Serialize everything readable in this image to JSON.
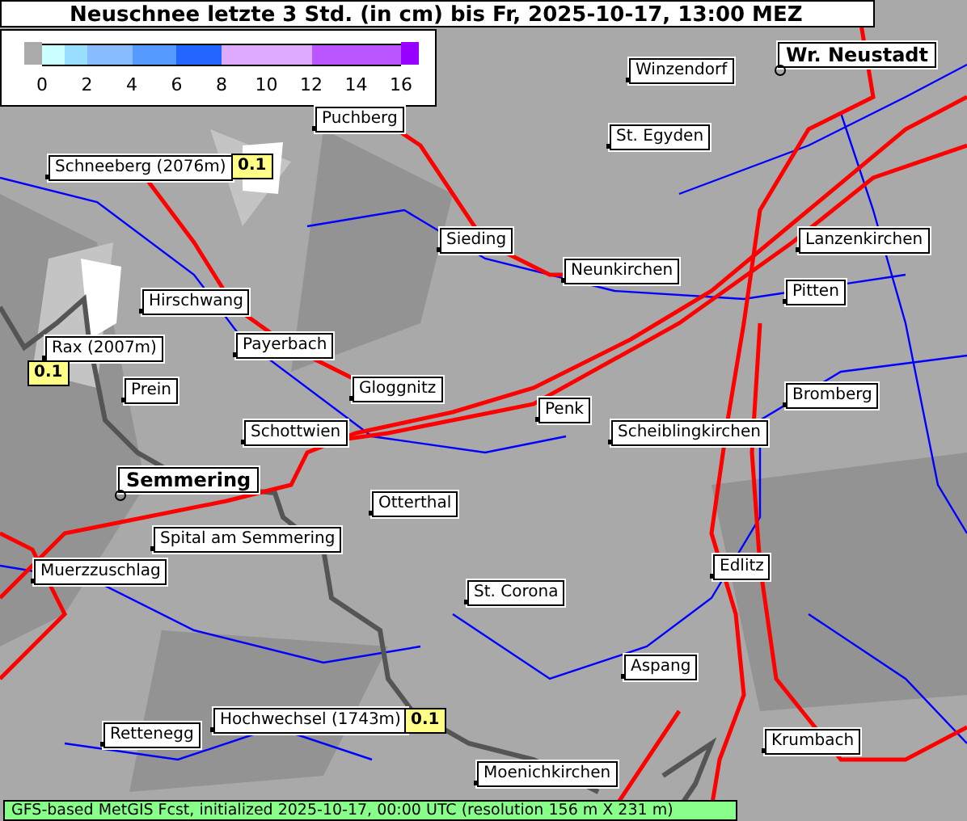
{
  "title": "Neuschnee letzte 3 Std. (in cm) bis Fr, 2025-10-17, 13:00 MEZ",
  "legend": {
    "ticks": [
      "0",
      "2",
      "4",
      "6",
      "8",
      "10",
      "12",
      "14",
      "16"
    ],
    "segments": [
      {
        "color": "#ccffff"
      },
      {
        "color": "#99ddff"
      },
      {
        "color": "#88bbff"
      },
      {
        "color": "#5599ff"
      },
      {
        "color": "#2266ff"
      },
      {
        "color": "#ddaaff"
      },
      {
        "color": "#bb55ff"
      }
    ]
  },
  "places": [
    {
      "name": "Winzendorf",
      "kind": "town"
    },
    {
      "name": "Wr. Neustadt",
      "kind": "city"
    },
    {
      "name": "Puchberg",
      "kind": "town"
    },
    {
      "name": "St. Egyden",
      "kind": "town"
    },
    {
      "name": "Schneeberg (2076m)",
      "kind": "peak",
      "value": "0.1"
    },
    {
      "name": "Sieding",
      "kind": "town"
    },
    {
      "name": "Neunkirchen",
      "kind": "town"
    },
    {
      "name": "Lanzenkirchen",
      "kind": "town"
    },
    {
      "name": "Pitten",
      "kind": "town"
    },
    {
      "name": "Hirschwang",
      "kind": "town"
    },
    {
      "name": "Payerbach",
      "kind": "town"
    },
    {
      "name": "Rax (2007m)",
      "kind": "peak",
      "value": "0.1"
    },
    {
      "name": "Prein",
      "kind": "town"
    },
    {
      "name": "Gloggnitz",
      "kind": "town"
    },
    {
      "name": "Bromberg",
      "kind": "town"
    },
    {
      "name": "Penk",
      "kind": "town"
    },
    {
      "name": "Schottwien",
      "kind": "town"
    },
    {
      "name": "Scheiblingkirchen",
      "kind": "town"
    },
    {
      "name": "Semmering",
      "kind": "city"
    },
    {
      "name": "Otterthal",
      "kind": "town"
    },
    {
      "name": "Spital am Semmering",
      "kind": "town"
    },
    {
      "name": "Edlitz",
      "kind": "town"
    },
    {
      "name": "Muerzzuschlag",
      "kind": "town"
    },
    {
      "name": "St. Corona",
      "kind": "town"
    },
    {
      "name": "Aspang",
      "kind": "town"
    },
    {
      "name": "Hochwechsel (1743m)",
      "kind": "peak",
      "value": "0.1"
    },
    {
      "name": "Rettenegg",
      "kind": "town"
    },
    {
      "name": "Krumbach",
      "kind": "town"
    },
    {
      "name": "Moenichkirchen",
      "kind": "town"
    }
  ],
  "footer": "GFS-based MetGIS Fcst, initialized 2025-10-17, 00:00 UTC (resolution 156 m X 231 m)"
}
